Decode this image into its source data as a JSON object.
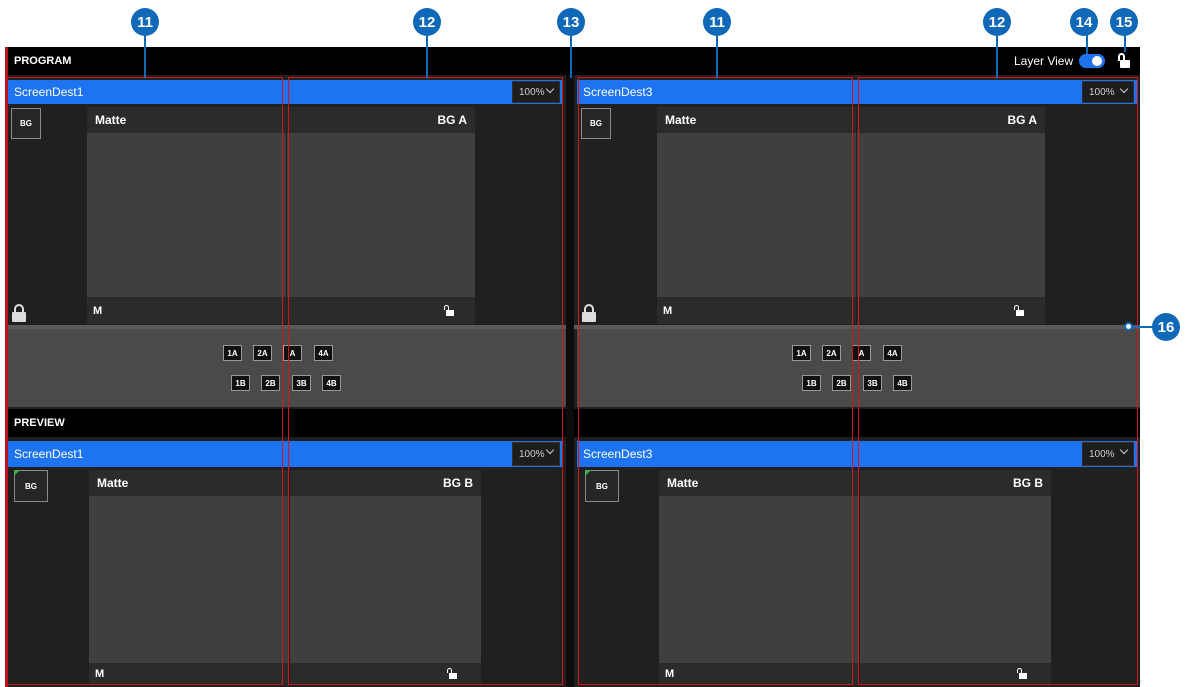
{
  "program": {
    "label": "PROGRAM",
    "layer_view_label": "Layer View",
    "layer_view_on": true,
    "dest_left": {
      "name": "ScreenDest1",
      "zoom": "100%",
      "bg_label": "BG",
      "layer_name": "Matte",
      "bg_layer": "BG A",
      "footer": "M"
    },
    "dest_right": {
      "name": "ScreenDest3",
      "zoom": "100%",
      "bg_label": "BG",
      "layer_name": "Matte",
      "bg_layer": "BG A",
      "footer": "M"
    },
    "presets_row1": [
      "1A",
      "2A",
      "A",
      "4A"
    ],
    "presets_row2": [
      "1B",
      "2B",
      "3B",
      "4B"
    ]
  },
  "preview": {
    "label": "PREVIEW",
    "dest_left": {
      "name": "ScreenDest1",
      "zoom": "100%",
      "bg_label": "BG",
      "layer_name": "Matte",
      "bg_layer": "BG B",
      "footer": "M"
    },
    "dest_right": {
      "name": "ScreenDest3",
      "zoom": "100%",
      "bg_label": "BG",
      "layer_name": "Matte",
      "bg_layer": "BG B",
      "footer": "M"
    }
  },
  "callouts": [
    "11",
    "12",
    "13",
    "11",
    "12",
    "14",
    "15",
    "16"
  ],
  "colors": {
    "accent_blue": "#1e74f0",
    "callout_blue": "#0f68b8",
    "highlight_red": "#d7141c",
    "background": "#202020"
  }
}
